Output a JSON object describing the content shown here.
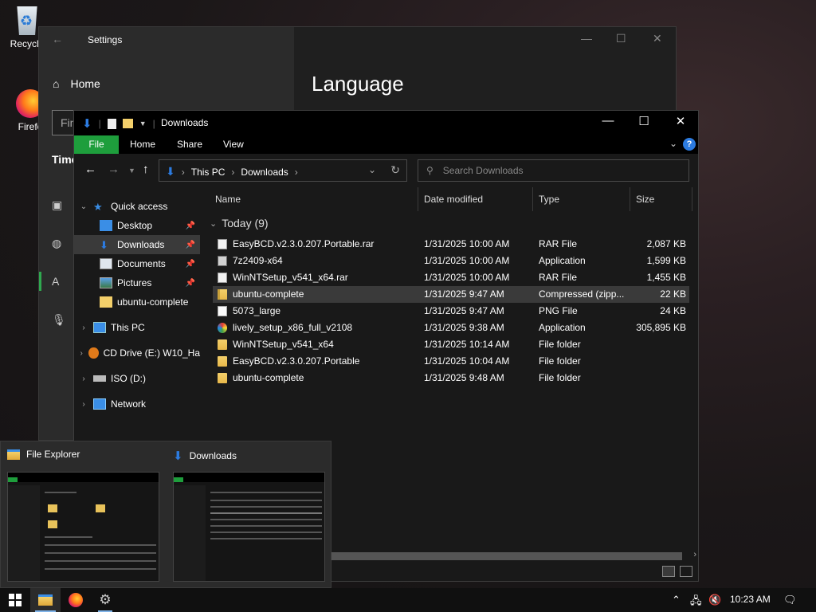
{
  "desktop": {
    "icons": [
      {
        "label": "Recycle"
      },
      {
        "label": "Firefo"
      }
    ]
  },
  "settings": {
    "title": "Settings",
    "home_label": "Home",
    "search_placeholder": "Fin",
    "category_label": "Time",
    "page_heading": "Language"
  },
  "explorer": {
    "title": "Downloads",
    "ribbon_tabs": [
      "File",
      "Home",
      "Share",
      "View"
    ],
    "address": {
      "crumbs": [
        "This PC",
        "Downloads"
      ]
    },
    "search_placeholder": "Search Downloads",
    "nav": [
      {
        "label": "Quick access",
        "icon": "star-icon",
        "expand": "open"
      },
      {
        "label": "Desktop",
        "icon": "desktop-icon",
        "pinned": true
      },
      {
        "label": "Downloads",
        "icon": "download-icon",
        "pinned": true,
        "selected": true
      },
      {
        "label": "Documents",
        "icon": "documents-icon",
        "pinned": true
      },
      {
        "label": "Pictures",
        "icon": "pictures-icon",
        "pinned": true
      },
      {
        "label": "ubuntu-complete",
        "icon": "folder-icon"
      },
      {
        "label": "This PC",
        "icon": "computer-icon",
        "expand": "closed"
      },
      {
        "label": "CD Drive (E:) W10_Ha",
        "icon": "cd-drive-icon",
        "expand": "closed"
      },
      {
        "label": "ISO (D:)",
        "icon": "drive-icon",
        "expand": "closed"
      },
      {
        "label": "Network",
        "icon": "network-icon",
        "expand": "closed"
      }
    ],
    "columns": [
      "Name",
      "Date modified",
      "Type",
      "Size"
    ],
    "group_label": "Today (9)",
    "files": [
      {
        "name": "EasyBCD.v2.3.0.207.Portable.rar",
        "date": "1/31/2025 10:00 AM",
        "type": "RAR File",
        "size": "2,087 KB",
        "icon": "file-icon"
      },
      {
        "name": "7z2409-x64",
        "date": "1/31/2025 10:00 AM",
        "type": "Application",
        "size": "1,599 KB",
        "icon": "app-icon"
      },
      {
        "name": "WinNTSetup_v541_x64.rar",
        "date": "1/31/2025 10:00 AM",
        "type": "RAR File",
        "size": "1,455 KB",
        "icon": "file-icon"
      },
      {
        "name": "ubuntu-complete",
        "date": "1/31/2025 9:47 AM",
        "type": "Compressed (zipp...",
        "size": "22 KB",
        "icon": "zip-folder-icon",
        "highlighted": true
      },
      {
        "name": "5073_large",
        "date": "1/31/2025 9:47 AM",
        "type": "PNG File",
        "size": "24 KB",
        "icon": "image-file-icon"
      },
      {
        "name": "lively_setup_x86_full_v2108",
        "date": "1/31/2025 9:38 AM",
        "type": "Application",
        "size": "305,895 KB",
        "icon": "lively-app-icon"
      },
      {
        "name": "WinNTSetup_v541_x64",
        "date": "1/31/2025 10:14 AM",
        "type": "File folder",
        "size": "",
        "icon": "folder-icon"
      },
      {
        "name": "EasyBCD.v2.3.0.207.Portable",
        "date": "1/31/2025 10:04 AM",
        "type": "File folder",
        "size": "",
        "icon": "folder-icon"
      },
      {
        "name": "ubuntu-complete",
        "date": "1/31/2025 9:48 AM",
        "type": "File folder",
        "size": "",
        "icon": "folder-icon"
      }
    ]
  },
  "thumbnails": [
    {
      "label": "File Explorer",
      "icon": "file-explorer-icon"
    },
    {
      "label": "Downloads",
      "icon": "download-icon"
    }
  ],
  "taskbar": {
    "clock": "10:23 AM"
  },
  "colors": {
    "accent_green": "#1e9e3c",
    "accent_blue": "#2c7be0"
  }
}
